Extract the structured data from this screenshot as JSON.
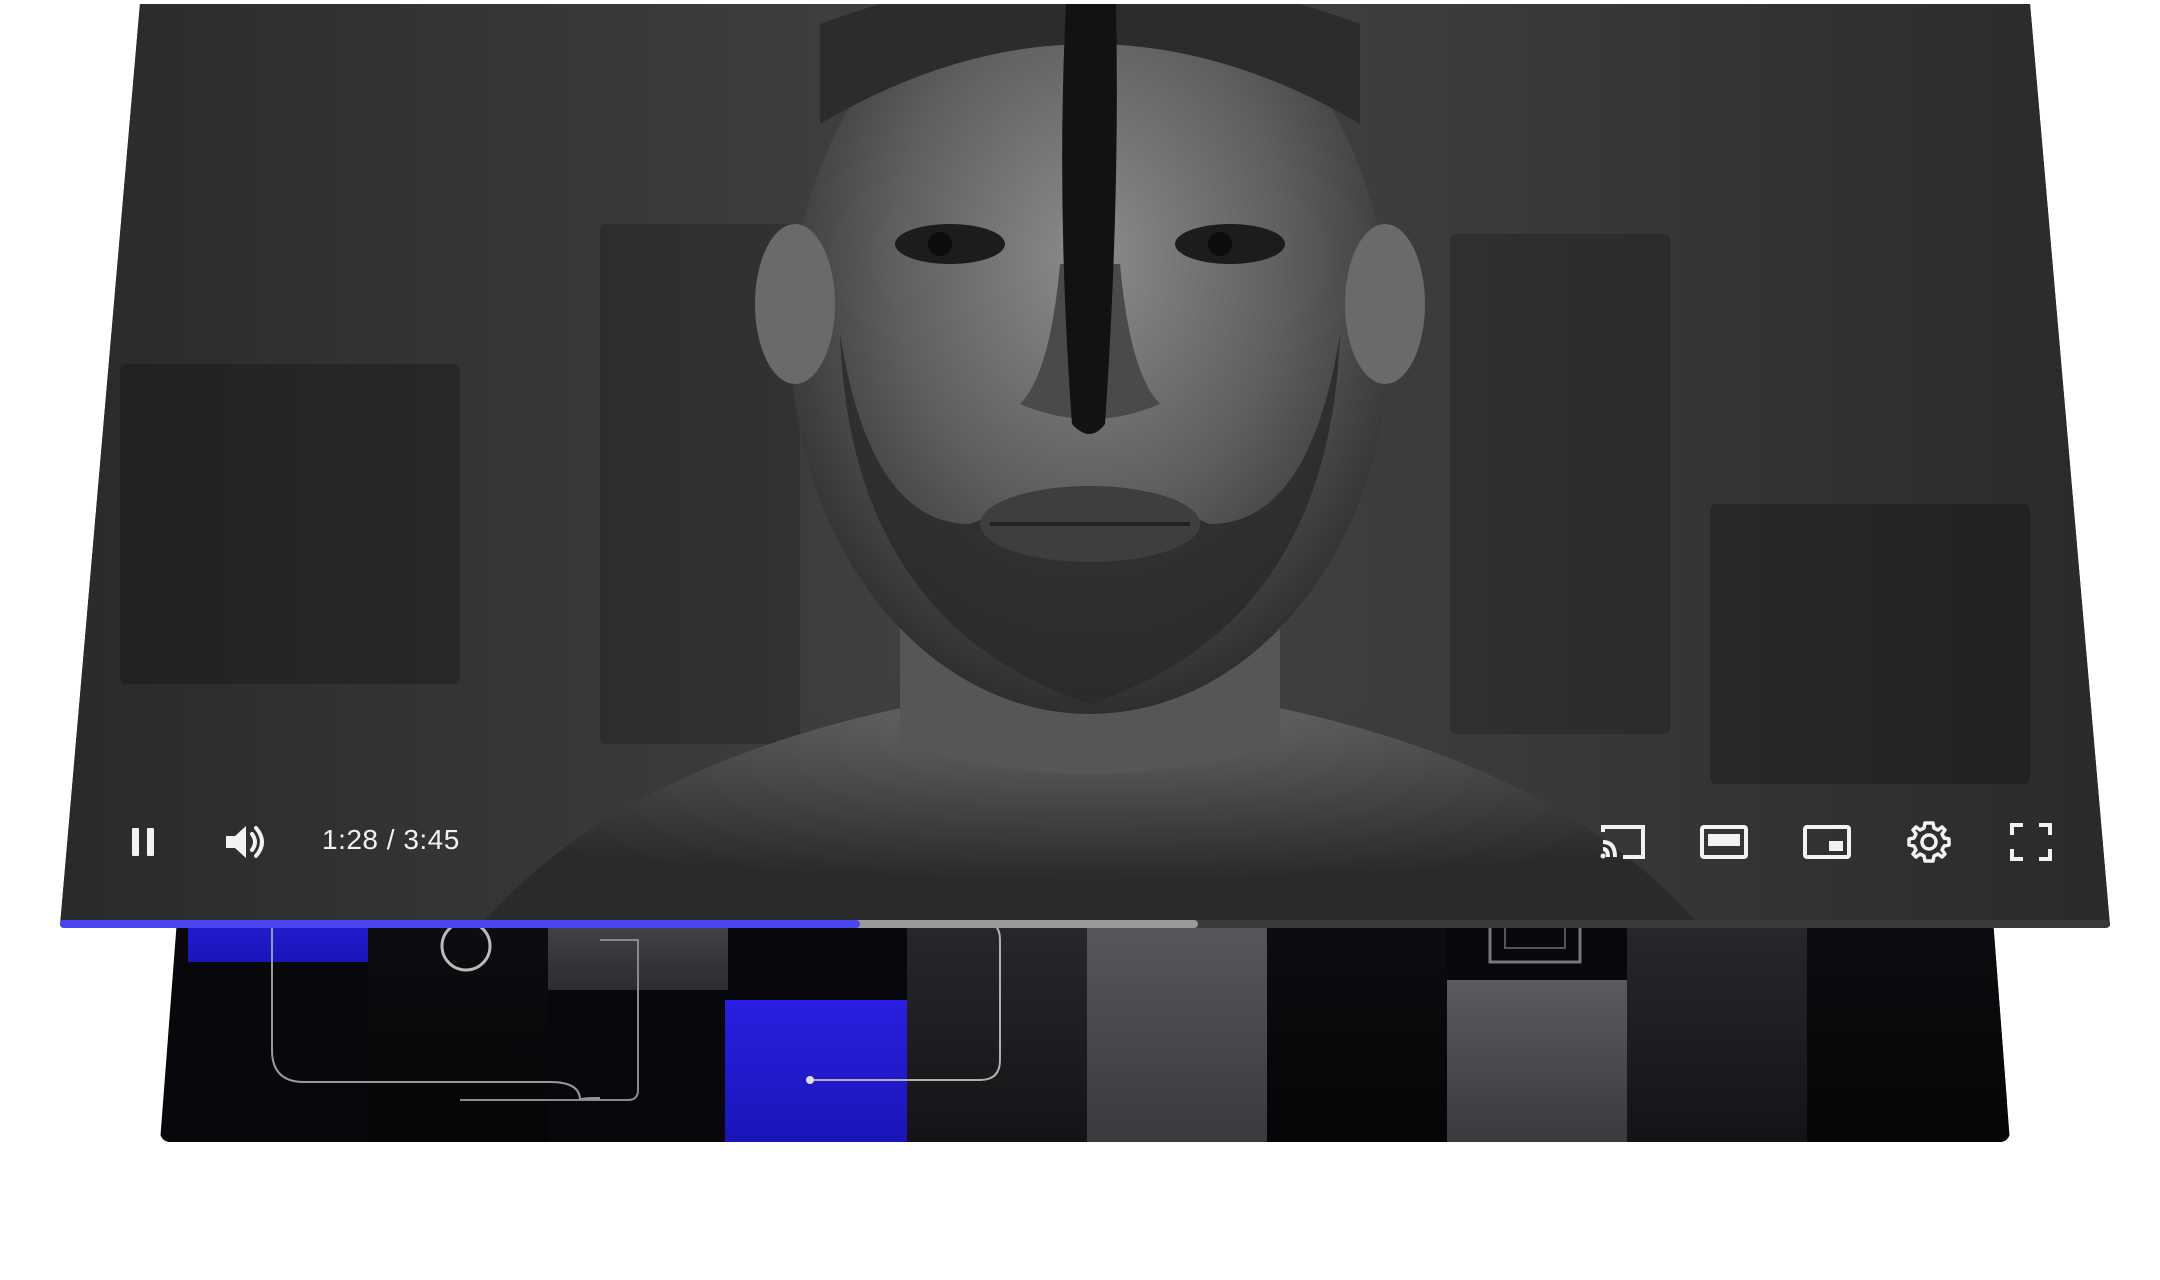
{
  "player": {
    "time_display": "1:28 / 3:45",
    "progress": {
      "played_fraction": 0.39,
      "buffered_fraction": 0.555
    },
    "controls_left": [
      {
        "name": "pause-button",
        "icon": "pause-icon"
      },
      {
        "name": "volume-button",
        "icon": "volume-icon"
      }
    ],
    "controls_right": [
      {
        "name": "cast-button",
        "icon": "cast-icon"
      },
      {
        "name": "theater-mode-button",
        "icon": "theater-mode-icon"
      },
      {
        "name": "miniplayer-button",
        "icon": "miniplayer-icon"
      },
      {
        "name": "settings-button",
        "icon": "gear-icon"
      },
      {
        "name": "fullscreen-button",
        "icon": "fullscreen-icon"
      }
    ]
  },
  "colors": {
    "accent": "#4a45f0",
    "tile_blue": "#1f19c8",
    "control_icon": "#f2f2f2"
  }
}
